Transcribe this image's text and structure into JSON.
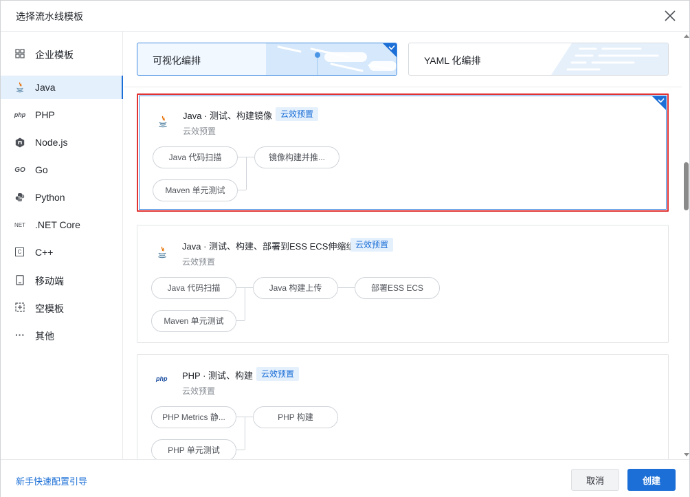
{
  "modal": {
    "title": "选择流水线模板",
    "close_icon": "close-icon"
  },
  "sidebar": {
    "items": [
      {
        "label": "企业模板",
        "icon": "grid-icon"
      },
      {
        "label": "Java",
        "icon": "java-icon",
        "active": true
      },
      {
        "label": "PHP",
        "icon": "php-icon",
        "icon_text": "php"
      },
      {
        "label": "Node.js",
        "icon": "nodejs-icon"
      },
      {
        "label": "Go",
        "icon": "go-icon",
        "icon_text": "GO"
      },
      {
        "label": "Python",
        "icon": "python-icon"
      },
      {
        "label": ".NET Core",
        "icon": "dotnet-icon",
        "icon_text": "NET"
      },
      {
        "label": "C++",
        "icon": "cpp-icon",
        "icon_text": "C"
      },
      {
        "label": "移动端",
        "icon": "mobile-icon"
      },
      {
        "label": "空模板",
        "icon": "empty-template-icon"
      },
      {
        "label": "其他",
        "icon": "more-icon",
        "icon_text": "···"
      }
    ]
  },
  "modes": {
    "visual": {
      "label": "可视化编排",
      "selected": true
    },
    "yaml": {
      "label": "YAML 化编排",
      "selected": false
    }
  },
  "templates": [
    {
      "title": "Java · 测试、构建镜像",
      "badge": "云效预置",
      "subtitle": "云效预置",
      "icon": "java-icon",
      "selected": true,
      "stages": {
        "col1": [
          "Java 代码扫描",
          "Maven 单元测试"
        ],
        "col2": [
          "镜像构建并推..."
        ]
      }
    },
    {
      "title": "Java · 测试、构建、部署到ESS ECS伸缩组",
      "badge": "云效预置",
      "subtitle": "云效预置",
      "icon": "java-icon",
      "selected": false,
      "stages": {
        "col1": [
          "Java 代码扫描",
          "Maven 单元测试"
        ],
        "col2": [
          "Java 构建上传"
        ],
        "col3": [
          "部署ESS ECS"
        ]
      }
    },
    {
      "title": "PHP · 测试、构建",
      "badge": "云效预置",
      "subtitle": "云效预置",
      "icon": "php-icon",
      "icon_text": "php",
      "selected": false,
      "stages": {
        "col1": [
          "PHP Metrics 静...",
          "PHP 单元测试"
        ],
        "col2": [
          "PHP 构建"
        ]
      }
    }
  ],
  "footer": {
    "guide_link": "新手快速配置引导",
    "cancel": "取消",
    "create": "创建"
  },
  "colors": {
    "primary": "#1b6fd6",
    "active_bg": "#e5f0fd",
    "selected_outline": "#e23232"
  }
}
